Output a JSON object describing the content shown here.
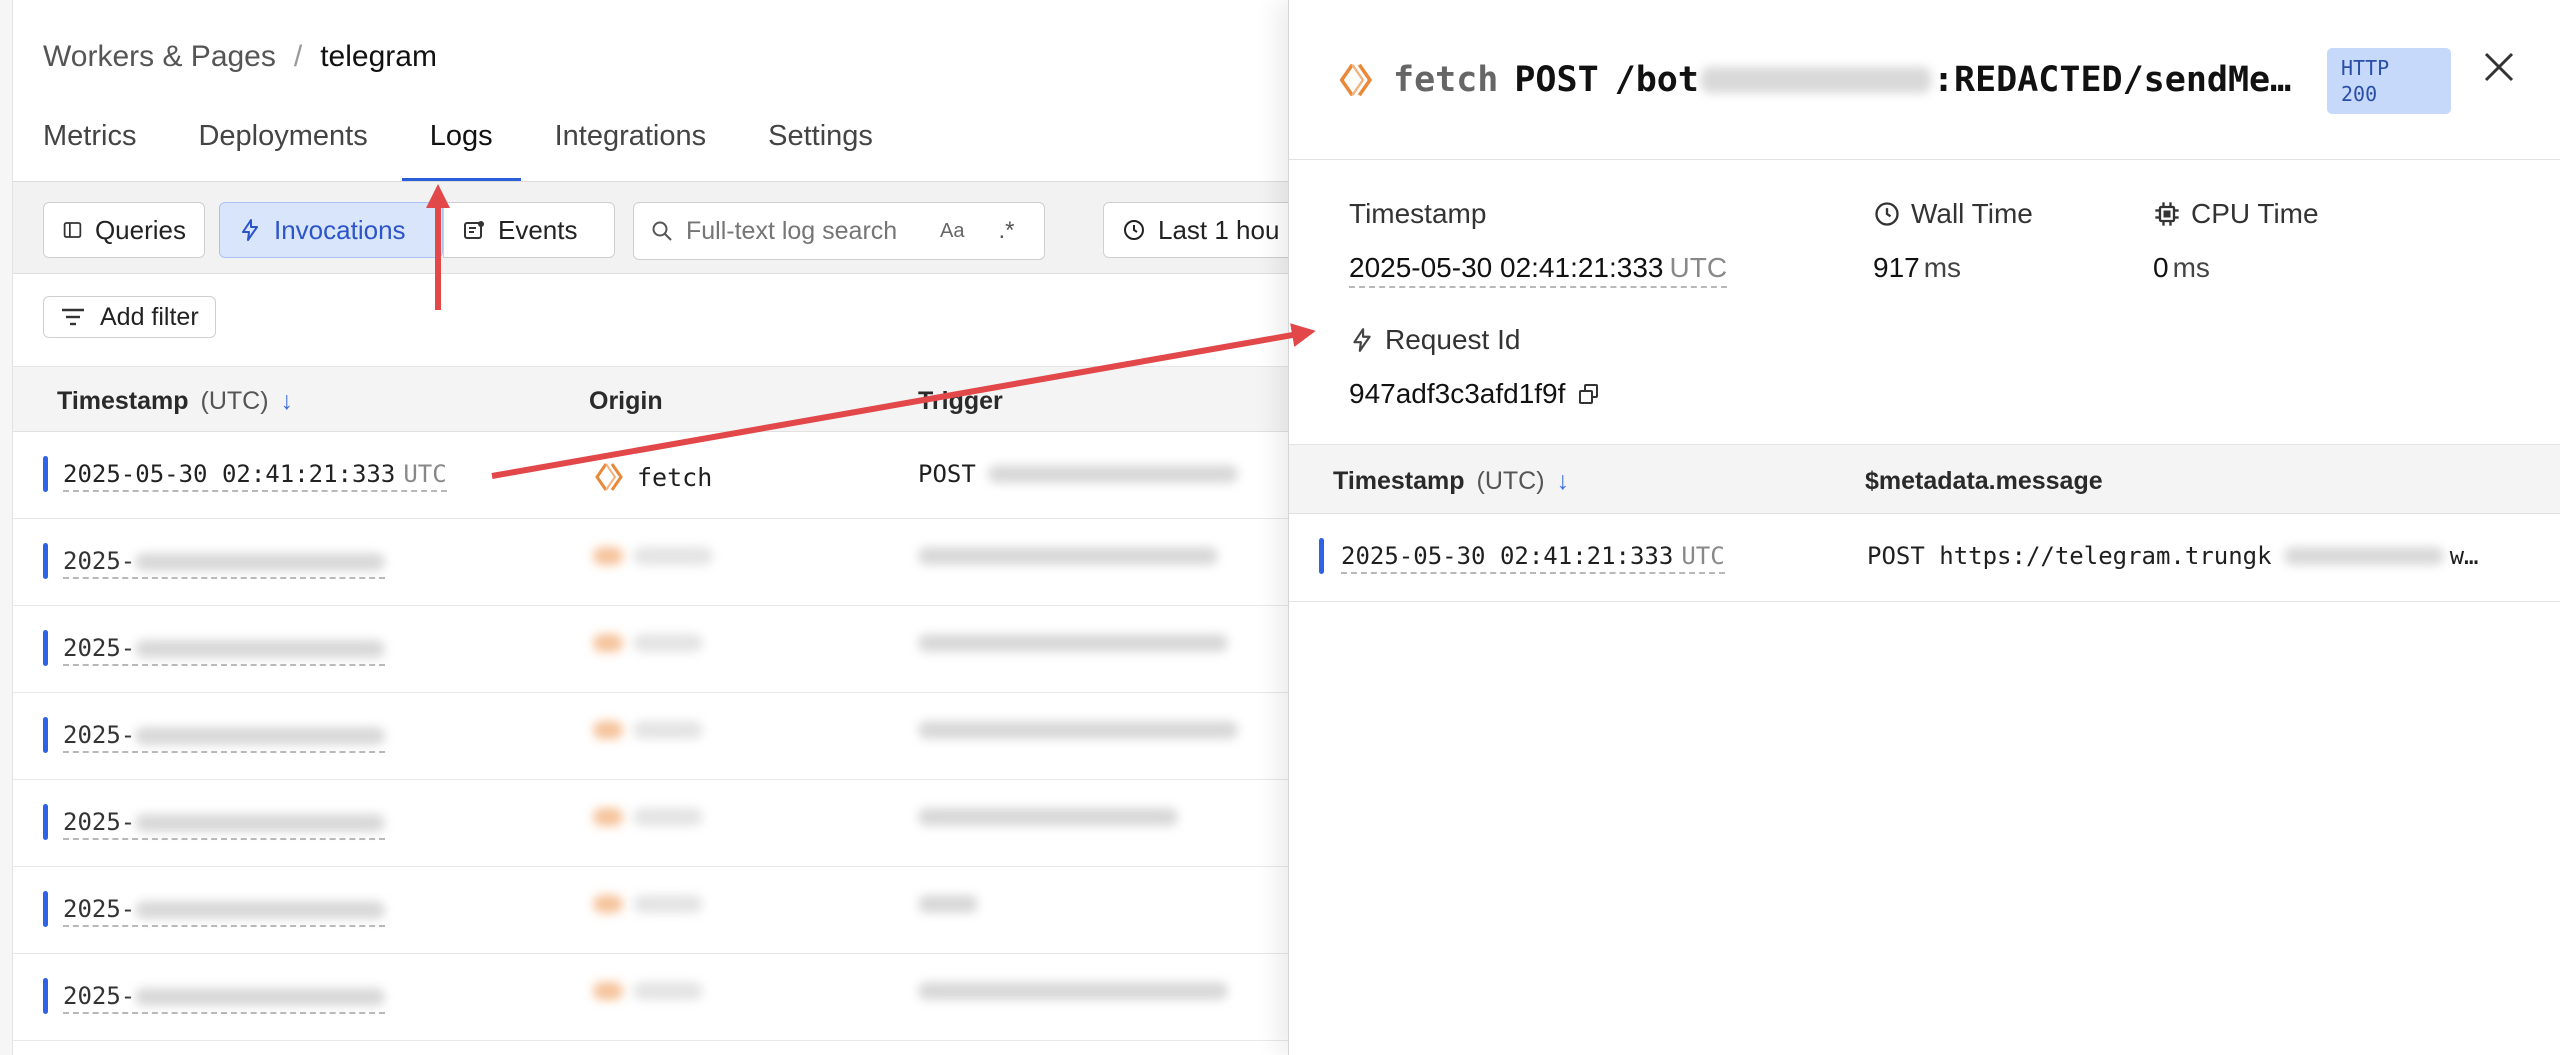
{
  "breadcrumb": {
    "parent": "Workers & Pages",
    "separator": "/",
    "current": "telegram"
  },
  "tabs": [
    {
      "label": "Metrics"
    },
    {
      "label": "Deployments"
    },
    {
      "label": "Logs",
      "active": true
    },
    {
      "label": "Integrations"
    },
    {
      "label": "Settings"
    }
  ],
  "toolbar": {
    "queries_label": "Queries",
    "invocations_label": "Invocations",
    "events_label": "Events",
    "search_placeholder": "Full-text log search",
    "case_toggle": "Aa",
    "regex_toggle": ".*",
    "time_range_label": "Last 1 hou"
  },
  "filter": {
    "add_label": "Add filter"
  },
  "table": {
    "columns": {
      "timestamp": "Timestamp",
      "timestamp_unit": "(UTC)",
      "sort_icon": "↓",
      "origin": "Origin",
      "trigger": "Trigger"
    },
    "rows": [
      {
        "timestamp": "2025-05-30 02:41:21:333",
        "tz": "UTC",
        "origin": "fetch",
        "trigger": "POST"
      },
      {
        "timestamp": "2025-",
        "tz": "",
        "origin": "",
        "trigger": ""
      },
      {
        "timestamp": "2025-",
        "tz": "",
        "origin": "",
        "trigger": ""
      },
      {
        "timestamp": "2025-",
        "tz": "",
        "origin": "",
        "trigger": ""
      },
      {
        "timestamp": "2025-",
        "tz": "",
        "origin": "",
        "trigger": ""
      },
      {
        "timestamp": "2025-",
        "tz": "",
        "origin": "",
        "trigger": ""
      },
      {
        "timestamp": "2025-",
        "tz": "",
        "origin": "",
        "trigger": ""
      }
    ]
  },
  "panel": {
    "kind": "fetch",
    "method": "POST",
    "path_prefix": "/bot",
    "path_suffix": ":REDACTED/sendMe…",
    "badge_line1": "HTTP",
    "badge_line2": "200",
    "close_glyph": "×",
    "timestamp_label": "Timestamp",
    "timestamp_value": "2025-05-30 02:41:21:333",
    "timestamp_tz": "UTC",
    "wall_time_label": "Wall Time",
    "wall_time_value": "917",
    "wall_time_unit": "ms",
    "cpu_time_label": "CPU Time",
    "cpu_time_value": "0",
    "cpu_time_unit": "ms",
    "request_id_label": "Request Id",
    "request_id_value": "947adf3c3afd1f9f",
    "table": {
      "timestamp": "Timestamp",
      "timestamp_unit": "(UTC)",
      "sort_icon": "↓",
      "message": "$metadata.message"
    },
    "row": {
      "timestamp": "2025-05-30 02:41:21:333",
      "tz": "UTC",
      "message_prefix": "POST https://telegram.trungk",
      "message_suffix": "w…"
    }
  },
  "colors": {
    "accent": "#2f63e6",
    "annotation": "#e2474a",
    "fetch_icon": "#e8893a",
    "badge_bg": "#c7d9fb"
  }
}
